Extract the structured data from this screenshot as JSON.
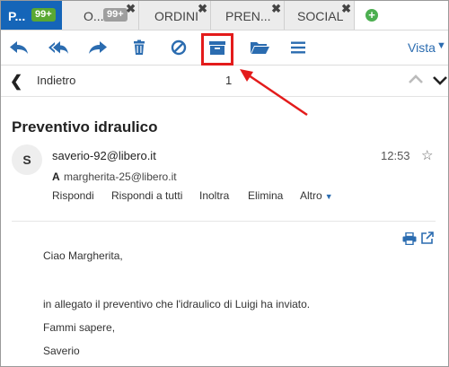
{
  "tabs": [
    {
      "label": "P...",
      "badge": "99+",
      "active": true
    },
    {
      "label": "O...",
      "badge": "99+",
      "active": false
    },
    {
      "label": "ORDINI",
      "active": false
    },
    {
      "label": "PREN...",
      "active": false
    },
    {
      "label": "SOCIAL",
      "active": false
    }
  ],
  "tab_close_glyph": "✖",
  "add_tab_glyph": "+",
  "toolbar": {
    "icons": [
      "reply-icon",
      "reply-all-icon",
      "forward-icon",
      "trash-icon",
      "block-icon",
      "archive-icon",
      "folder-icon",
      "menu-icon"
    ],
    "view_label": "Vista",
    "view_caret": "▼",
    "highlighted": "archive-icon",
    "highlight_color": "#e31b1b"
  },
  "nav": {
    "back_glyph": "❮",
    "back_label": "Indietro",
    "page_number": "1"
  },
  "message": {
    "subject": "Preventivo idraulico",
    "avatar_initial": "S",
    "sender": "saverio-92@libero.it",
    "time": "12:53",
    "star_glyph": "☆",
    "to_prefix": "A",
    "to_address": "margherita-25@libero.it",
    "actions": {
      "reply": "Rispondi",
      "reply_all": "Rispondi a tutti",
      "forward": "Inoltra",
      "delete": "Elimina",
      "more": "Altro",
      "more_caret": "▼"
    },
    "body": {
      "greeting": "Ciao Margherita,",
      "line1": "in allegato il preventivo che l'idraulico di Luigi ha inviato.",
      "line2": "Fammi sapere,",
      "signature": "Saverio"
    }
  },
  "colors": {
    "accent": "#2b6cb0",
    "active_tab": "#1565b8",
    "badge_green": "#5aa832",
    "badge_grey": "#9e9e9e"
  }
}
